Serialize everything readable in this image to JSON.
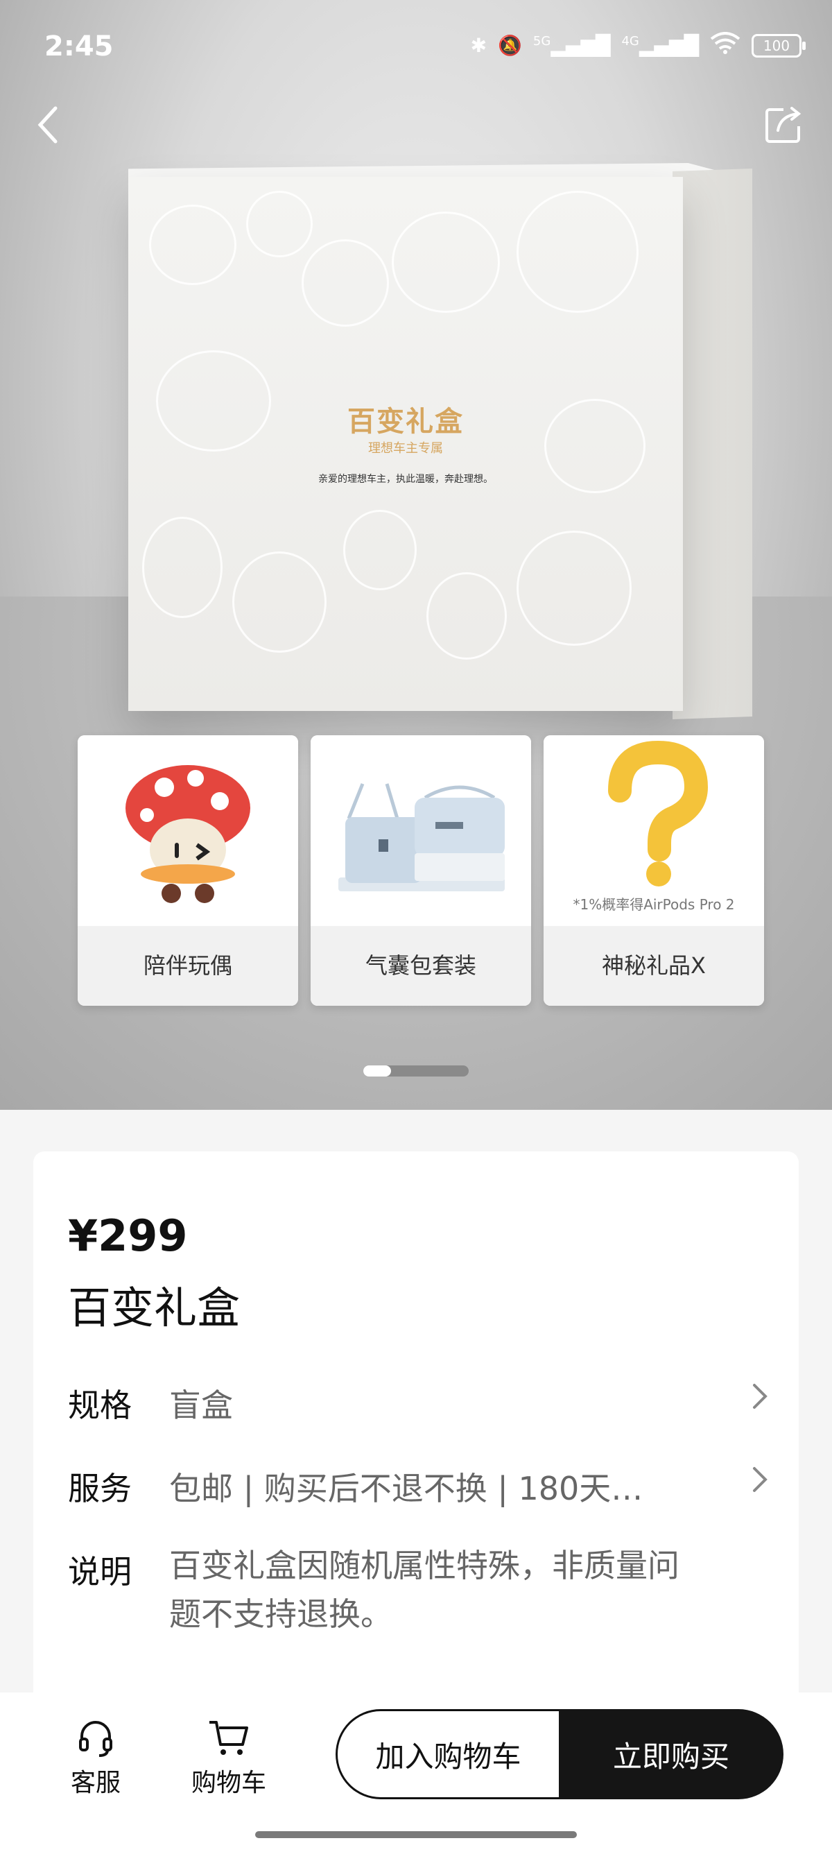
{
  "status_bar": {
    "time": "2:45",
    "signal_5g": "5G",
    "signal_4g": "4G",
    "battery": "100"
  },
  "nav": {
    "back_icon": "chevron-left-icon",
    "share_icon": "share-icon"
  },
  "gallery": {
    "box_title": "百变礼盒",
    "box_subtitle": "理想车主专属",
    "box_message": "亲爱的理想车主，执此温暖，奔赴理想。",
    "cards": [
      {
        "label": "陪伴玩偶",
        "note": ""
      },
      {
        "label": "气囊包套装",
        "note": ""
      },
      {
        "label": "神秘礼品X",
        "note": "*1%概率得AirPods Pro 2"
      }
    ],
    "pager": {
      "current": 1,
      "total": 4
    }
  },
  "product": {
    "price": "¥299",
    "name": "百变礼盒",
    "rows": [
      {
        "key": "规格",
        "value": "盲盒"
      },
      {
        "key": "服务",
        "value": "包邮 | 购买后不退不换 | 180天质..."
      },
      {
        "key": "说明",
        "value": "百变礼盒因随机属性特殊，非质量问题不支持退换。"
      }
    ]
  },
  "bottom_bar": {
    "service_label": "客服",
    "cart_label": "购物车",
    "add_to_cart": "加入购物车",
    "buy_now": "立即购买"
  }
}
